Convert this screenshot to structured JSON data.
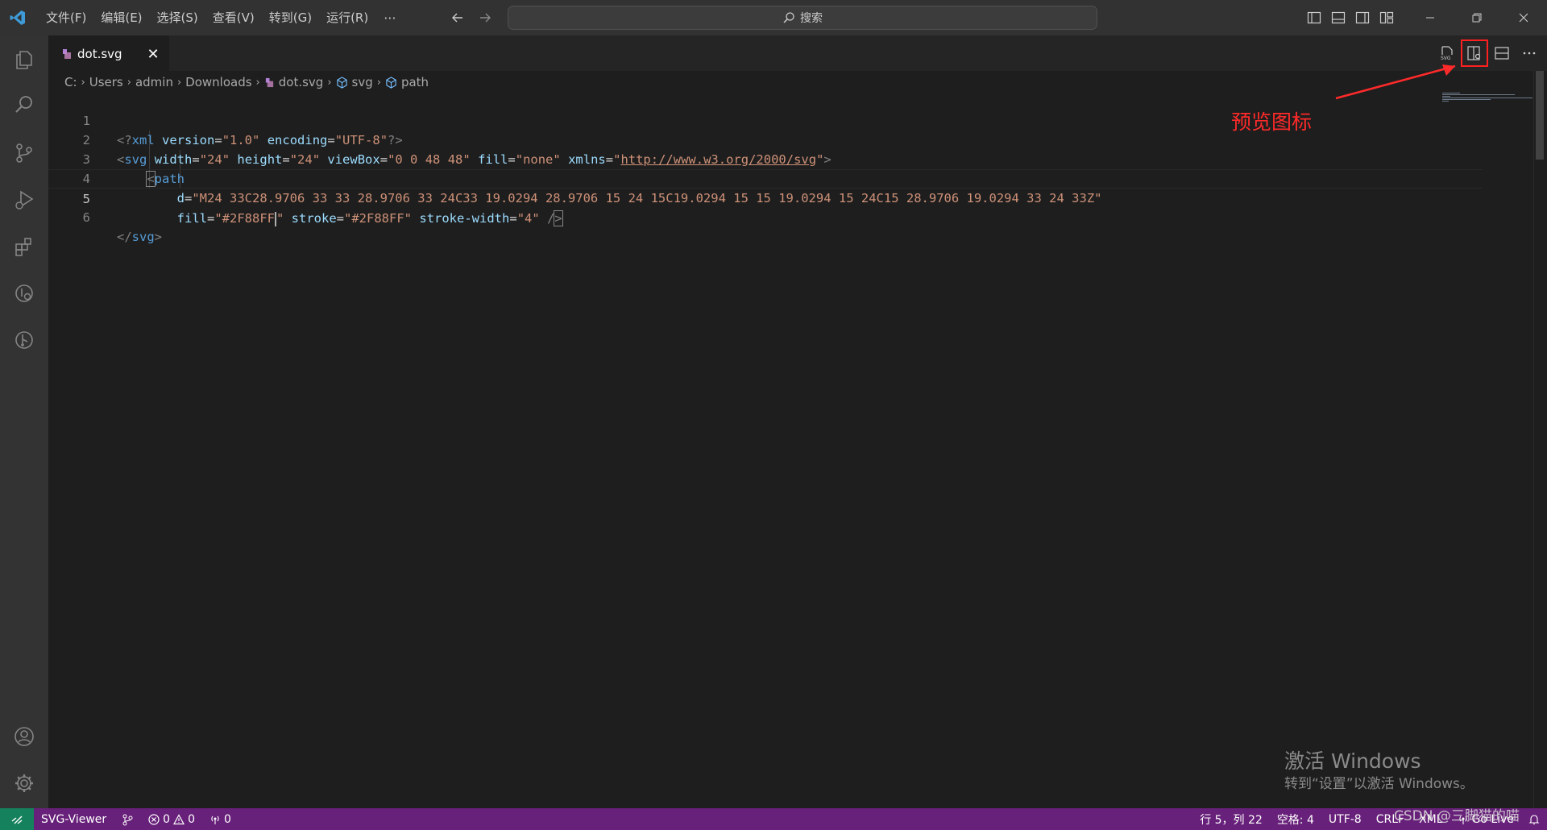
{
  "titlebar": {
    "menu": [
      "文件(F)",
      "编辑(E)",
      "选择(S)",
      "查看(V)",
      "转到(G)",
      "运行(R)"
    ],
    "more": "···",
    "search_label": "搜索"
  },
  "tab": {
    "filename": "dot.svg",
    "close": "✕"
  },
  "breadcrumbs": [
    "C:",
    "Users",
    "admin",
    "Downloads",
    "dot.svg",
    "svg",
    "path"
  ],
  "editor": {
    "line_numbers": [
      "1",
      "2",
      "3",
      "4",
      "5",
      "6"
    ],
    "cursor_line": 5,
    "xml_decl": {
      "open": "<?",
      "tag": "xml",
      "attrs": [
        {
          "name": "version",
          "value": "\"1.0\""
        },
        {
          "name": "encoding",
          "value": "\"UTF-8\""
        }
      ],
      "close": "?>"
    },
    "svg_open": {
      "open": "<",
      "tag": "svg",
      "width_attr": "width",
      "width_val": "\"24\"",
      "height_attr": "height",
      "height_val": "\"24\"",
      "viewbox_attr": "viewBox",
      "viewbox_val": "\"0 0 48 48\"",
      "fill_attr": "fill",
      "fill_val": "\"none\"",
      "xmlns_attr": "xmlns",
      "xmlns_q1": "\"",
      "xmlns_url": "http://www.w3.org/2000/svg",
      "xmlns_q2": "\"",
      "close": ">"
    },
    "path_open": {
      "open": "<",
      "tag": "path"
    },
    "path_d": {
      "attr": "d",
      "value": "\"M24 33C28.9706 33 33 28.9706 33 24C33 19.0294 28.9706 15 24 15C19.0294 15 15 19.0294 15 24C15 28.9706 19.0294 33 24 33Z\""
    },
    "path_fill": {
      "fill_attr": "fill",
      "fill_val_a": "\"#2F88FF",
      "fill_val_b": "\"",
      "stroke_attr": "stroke",
      "stroke_val": "\"#2F88FF\"",
      "sw_attr": "stroke-width",
      "sw_val": "\"4\"",
      "self_close_a": "/",
      "self_close_b": ">"
    },
    "svg_close": {
      "open": "</",
      "tag": "svg",
      "close": ">"
    }
  },
  "annotation": {
    "text": "预览图标",
    "color": "#ff2a2a"
  },
  "watermark": {
    "title": "激活 Windows",
    "subtitle": "转到“设置”以激活 Windows。"
  },
  "statusbar": {
    "color": "#68217a",
    "remote_color": "#16825d",
    "svg_viewer": "SVG-Viewer",
    "errors": "0",
    "warnings": "0",
    "ports": "0",
    "position": "行 5，列 22",
    "spaces": "空格: 4",
    "encoding": "UTF-8",
    "eol": "CRLF",
    "language": "XML",
    "go_live": "Go Live"
  },
  "csdn_watermark": "CSDN @三脚猫的喵"
}
